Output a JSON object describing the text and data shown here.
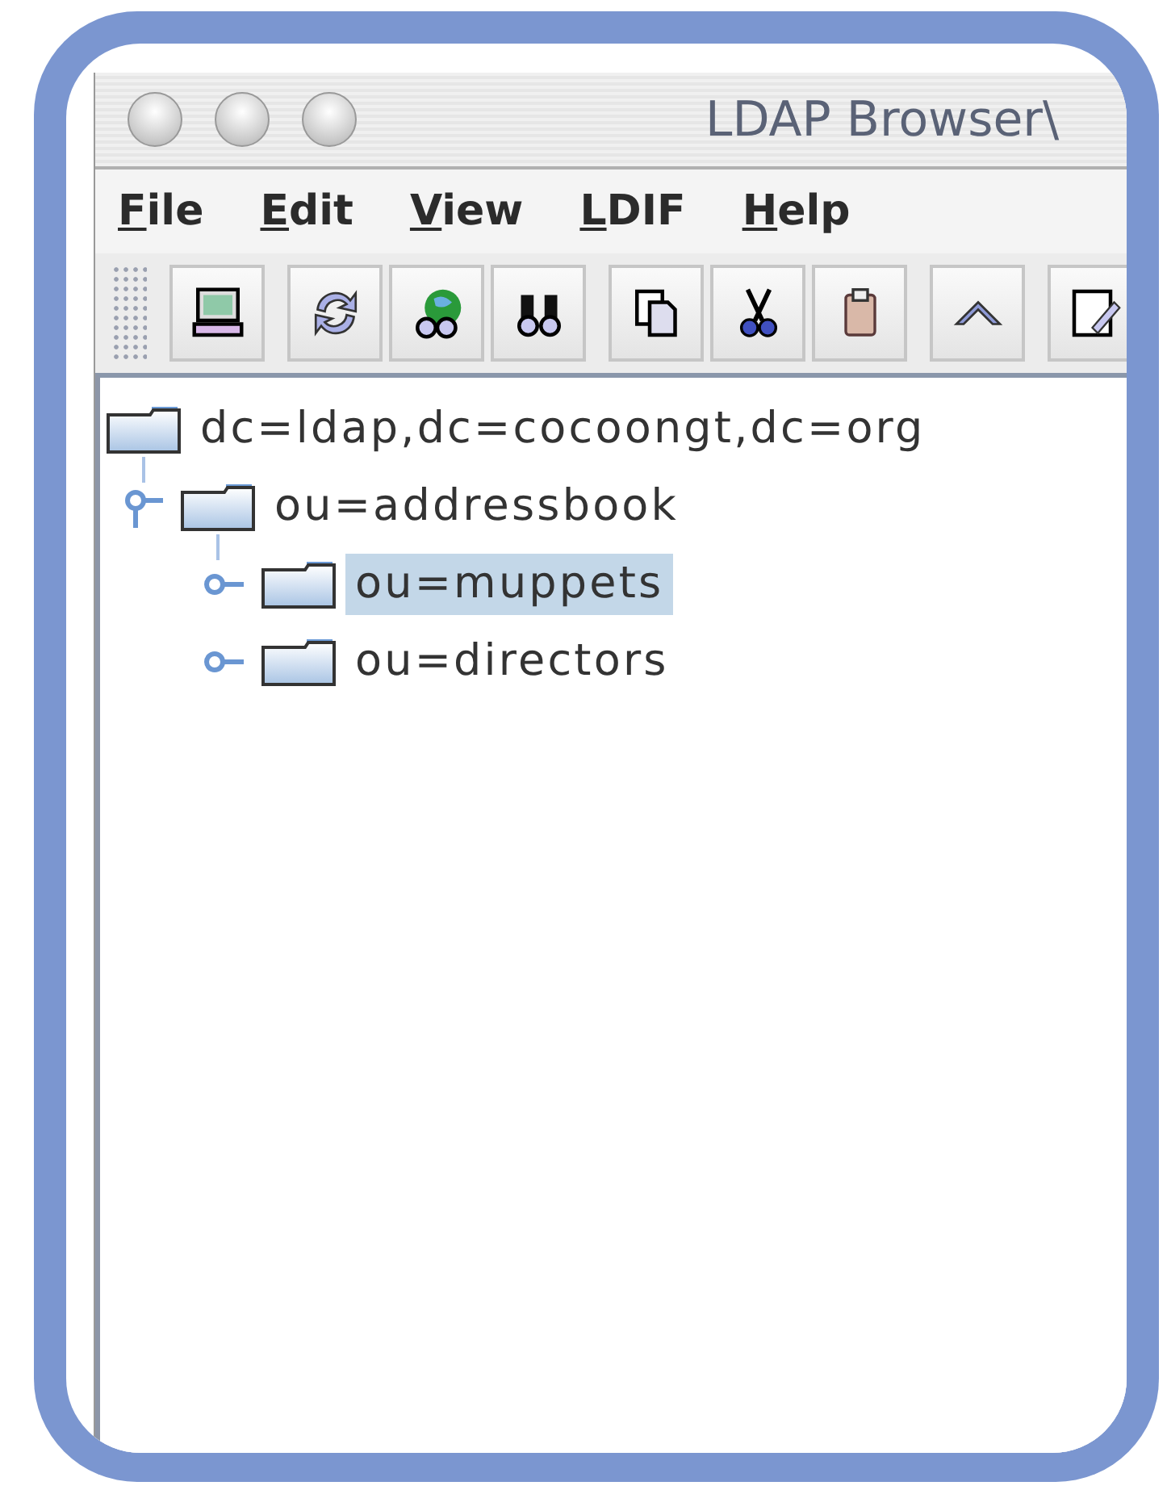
{
  "window": {
    "title": "LDAP Browser\\"
  },
  "menu": [
    {
      "label": "File"
    },
    {
      "label": "Edit"
    },
    {
      "label": "View"
    },
    {
      "label": "LDIF"
    },
    {
      "label": "Help"
    }
  ],
  "toolbar": {
    "groups": [
      [
        {
          "kind": "computer"
        }
      ],
      [
        {
          "kind": "refresh"
        },
        {
          "kind": "globe"
        },
        {
          "kind": "binoculars"
        }
      ],
      [
        {
          "kind": "copy"
        },
        {
          "kind": "cut"
        },
        {
          "kind": "paste"
        }
      ],
      [
        {
          "kind": "up"
        }
      ],
      [
        {
          "kind": "edit"
        }
      ]
    ]
  },
  "tree": {
    "show_root_handles": false,
    "nodes": [
      {
        "label": "dc=ldap,dc=cocoongt,dc=org",
        "expanded": true,
        "selected": false,
        "children": [
          {
            "label": "ou=addressbook",
            "expanded": true,
            "selected": false,
            "children": [
              {
                "label": "ou=muppets",
                "expanded": false,
                "selected": true
              },
              {
                "label": "ou=directors",
                "expanded": false,
                "selected": false
              }
            ]
          }
        ]
      }
    ]
  }
}
